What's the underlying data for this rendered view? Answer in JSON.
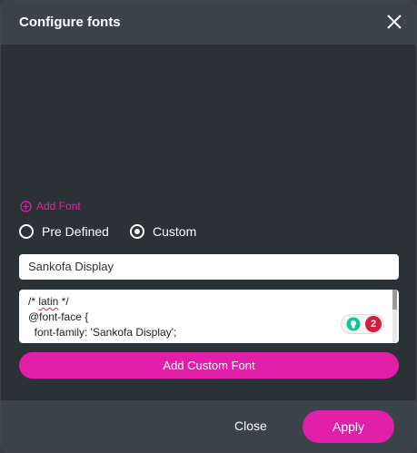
{
  "dialog": {
    "title": "Configure fonts",
    "close_icon": "close-icon"
  },
  "add_font": {
    "label": "Add Font",
    "icon": "plus-circle-icon"
  },
  "font_type": {
    "options": [
      "Pre Defined",
      "Custom"
    ],
    "selected": "Custom"
  },
  "font_name": {
    "value": "Sankofa Display"
  },
  "css_code": {
    "lines": [
      "/* latin */",
      "@font-face {",
      "  font-family: 'Sankofa Display';"
    ]
  },
  "grammar_widget": {
    "icon": "lightbulb-icon",
    "count": "2"
  },
  "actions": {
    "add_custom_font": "Add Custom Font",
    "close": "Close",
    "apply": "Apply"
  },
  "colors": {
    "accent": "#e21fa8",
    "background": "#2b3236",
    "header": "#3a4349"
  }
}
